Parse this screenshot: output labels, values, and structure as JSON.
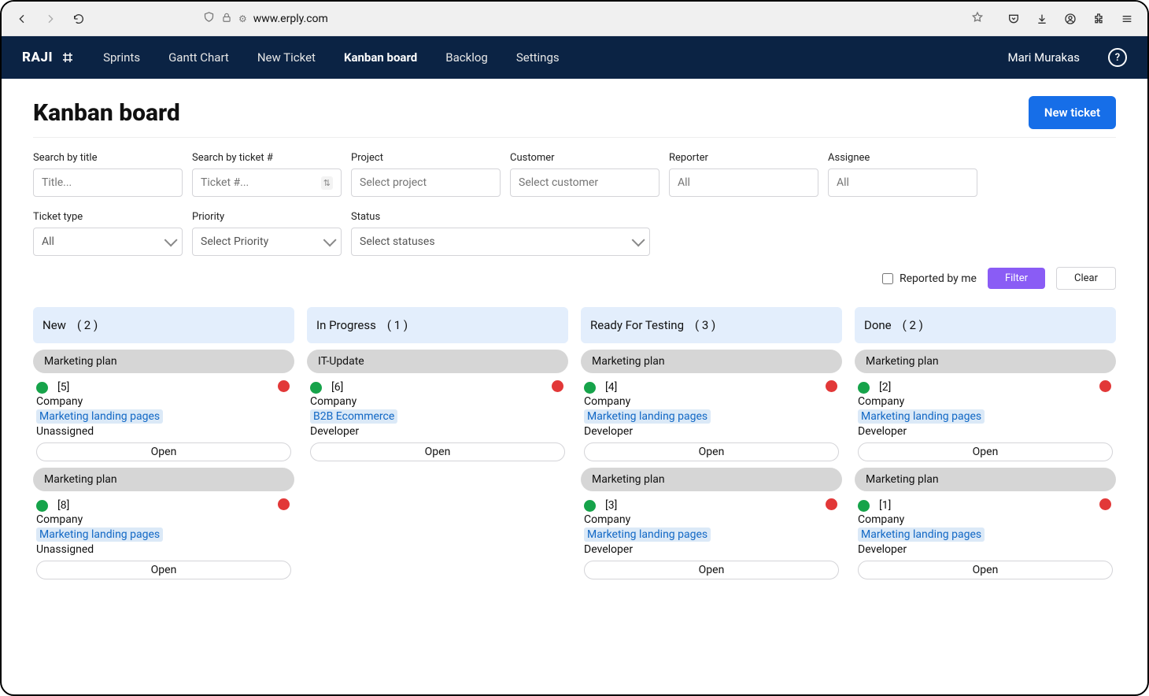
{
  "browser": {
    "url": "www.erply.com"
  },
  "nav": {
    "brand": "RAJI",
    "items": [
      "Sprints",
      "Gantt Chart",
      "New Ticket",
      "Kanban board",
      "Backlog",
      "Settings"
    ],
    "active_index": 3,
    "user": "Mari Murakas"
  },
  "header": {
    "title": "Kanban board",
    "new_ticket_label": "New ticket"
  },
  "filters": {
    "search_title": {
      "label": "Search by title",
      "placeholder": "Title..."
    },
    "search_ticket": {
      "label": "Search by ticket #",
      "placeholder": "Ticket #..."
    },
    "project": {
      "label": "Project",
      "placeholder": "Select project"
    },
    "customer": {
      "label": "Customer",
      "placeholder": "Select customer"
    },
    "reporter": {
      "label": "Reporter",
      "placeholder": "All"
    },
    "assignee": {
      "label": "Assignee",
      "placeholder": "All"
    },
    "ticket_type": {
      "label": "Ticket type",
      "value": "All"
    },
    "priority": {
      "label": "Priority",
      "value": "Select Priority"
    },
    "status": {
      "label": "Status",
      "value": "Select statuses"
    },
    "reported_by_me": "Reported by me",
    "filter_btn": "Filter",
    "clear_btn": "Clear"
  },
  "columns": [
    {
      "name": "New",
      "count": "( 2 )",
      "cards": [
        {
          "title": "Marketing plan",
          "id": "[5]",
          "company": "Company",
          "tag": "Marketing landing pages",
          "assignee": "Unassigned",
          "status": "Open"
        },
        {
          "title": "Marketing plan",
          "id": "[8]",
          "company": "Company",
          "tag": "Marketing landing pages",
          "assignee": "Unassigned",
          "status": "Open"
        }
      ]
    },
    {
      "name": "In Progress",
      "count": "( 1 )",
      "cards": [
        {
          "title": "IT-Update",
          "id": "[6]",
          "company": "Company",
          "tag": "B2B Ecommerce",
          "assignee": "Developer",
          "status": "Open"
        }
      ]
    },
    {
      "name": "Ready For Testing",
      "count": "( 3 )",
      "cards": [
        {
          "title": "Marketing plan",
          "id": "[4]",
          "company": "Company",
          "tag": "Marketing landing pages",
          "assignee": "Developer",
          "status": "Open"
        },
        {
          "title": "Marketing plan",
          "id": "[3]",
          "company": "Company",
          "tag": "Marketing landing pages",
          "assignee": "Developer",
          "status": "Open"
        }
      ]
    },
    {
      "name": "Done",
      "count": "( 2 )",
      "cards": [
        {
          "title": "Marketing plan",
          "id": "[2]",
          "company": "Company",
          "tag": "Marketing landing pages",
          "assignee": "Developer",
          "status": "Open"
        },
        {
          "title": "Marketing plan",
          "id": "[1]",
          "company": "Company",
          "tag": "Marketing landing pages",
          "assignee": "Developer",
          "status": "Open"
        }
      ]
    }
  ]
}
